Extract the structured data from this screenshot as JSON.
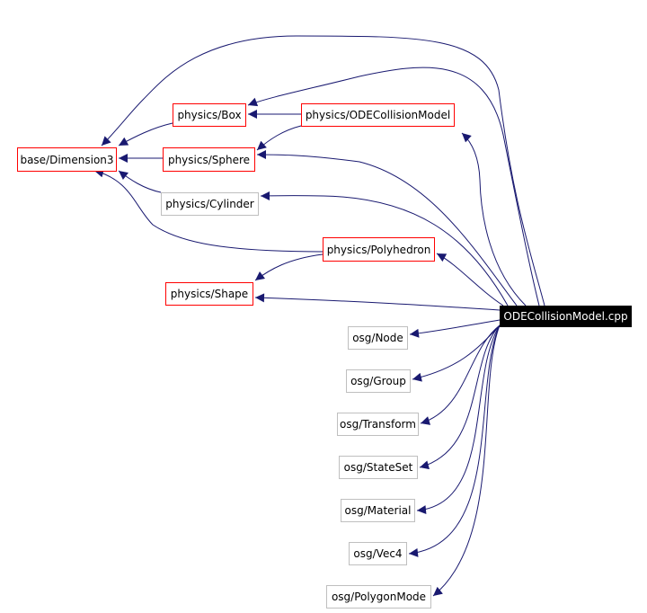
{
  "edge_color": "#191970",
  "nodes": {
    "root": {
      "label": "ODECollisionModel.cpp",
      "style": "root"
    },
    "dim": {
      "label": "base/Dimension3",
      "style": "red"
    },
    "box": {
      "label": "physics/Box",
      "style": "red"
    },
    "ode": {
      "label": "physics/ODECollisionModel",
      "style": "red"
    },
    "sphere": {
      "label": "physics/Sphere",
      "style": "red"
    },
    "cylinder": {
      "label": "physics/Cylinder",
      "style": "gray"
    },
    "poly": {
      "label": "physics/Polyhedron",
      "style": "red"
    },
    "shape": {
      "label": "physics/Shape",
      "style": "red"
    },
    "node": {
      "label": "osg/Node",
      "style": "gray"
    },
    "group": {
      "label": "osg/Group",
      "style": "gray"
    },
    "transform": {
      "label": "osg/Transform",
      "style": "gray"
    },
    "stateset": {
      "label": "osg/StateSet",
      "style": "gray"
    },
    "material": {
      "label": "osg/Material",
      "style": "gray"
    },
    "vec4": {
      "label": "osg/Vec4",
      "style": "gray"
    },
    "polygonmode": {
      "label": "osg/PolygonMode",
      "style": "gray"
    }
  },
  "edges": [
    {
      "from": "root",
      "to": "ode"
    },
    {
      "from": "root",
      "to": "box"
    },
    {
      "from": "root",
      "to": "dim"
    },
    {
      "from": "root",
      "to": "sphere"
    },
    {
      "from": "root",
      "to": "cylinder"
    },
    {
      "from": "root",
      "to": "poly"
    },
    {
      "from": "root",
      "to": "shape"
    },
    {
      "from": "root",
      "to": "node"
    },
    {
      "from": "root",
      "to": "group"
    },
    {
      "from": "root",
      "to": "transform"
    },
    {
      "from": "root",
      "to": "stateset"
    },
    {
      "from": "root",
      "to": "material"
    },
    {
      "from": "root",
      "to": "vec4"
    },
    {
      "from": "root",
      "to": "polygonmode"
    },
    {
      "from": "ode",
      "to": "box"
    },
    {
      "from": "ode",
      "to": "sphere"
    },
    {
      "from": "box",
      "to": "dim"
    },
    {
      "from": "sphere",
      "to": "dim"
    },
    {
      "from": "cylinder",
      "to": "dim"
    },
    {
      "from": "poly",
      "to": "dim"
    },
    {
      "from": "poly",
      "to": "shape"
    }
  ]
}
